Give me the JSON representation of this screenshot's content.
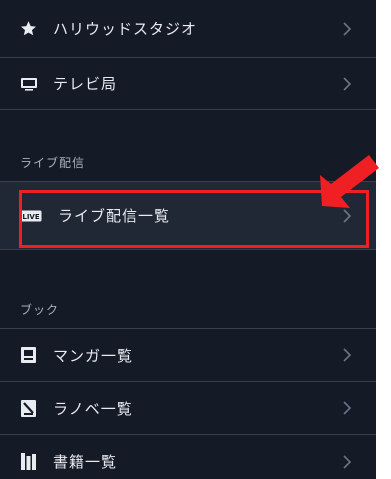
{
  "menu": {
    "items": [
      {
        "label": "ハリウッドスタジオ",
        "icon": "star-icon"
      },
      {
        "label": "テレビ局",
        "icon": "tv-icon"
      }
    ]
  },
  "live_section": {
    "header": "ライブ配信",
    "item": {
      "label": "ライブ配信一覧",
      "icon": "live-badge-icon",
      "badge_text": "LIVE"
    }
  },
  "book_section": {
    "header": "ブック",
    "items": [
      {
        "label": "マンガ一覧",
        "icon": "manga-icon"
      },
      {
        "label": "ラノベ一覧",
        "icon": "light-novel-icon"
      },
      {
        "label": "書籍一覧",
        "icon": "books-icon"
      }
    ]
  },
  "annotation": {
    "highlight_color": "#ef1f23"
  },
  "colors": {
    "background": "#141a26",
    "divider": "#39404c",
    "text": "#e8ebf0",
    "section_text": "#aab1bd"
  }
}
